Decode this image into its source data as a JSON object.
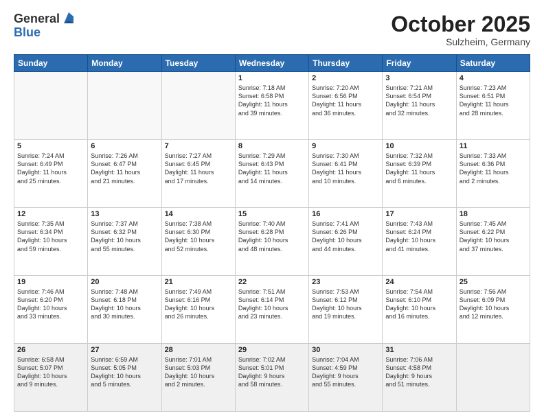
{
  "header": {
    "logo_general": "General",
    "logo_blue": "Blue",
    "month_title": "October 2025",
    "subtitle": "Sulzheim, Germany"
  },
  "days_of_week": [
    "Sunday",
    "Monday",
    "Tuesday",
    "Wednesday",
    "Thursday",
    "Friday",
    "Saturday"
  ],
  "weeks": [
    [
      {
        "day": "",
        "info": ""
      },
      {
        "day": "",
        "info": ""
      },
      {
        "day": "",
        "info": ""
      },
      {
        "day": "1",
        "info": "Sunrise: 7:18 AM\nSunset: 6:58 PM\nDaylight: 11 hours\nand 39 minutes."
      },
      {
        "day": "2",
        "info": "Sunrise: 7:20 AM\nSunset: 6:56 PM\nDaylight: 11 hours\nand 36 minutes."
      },
      {
        "day": "3",
        "info": "Sunrise: 7:21 AM\nSunset: 6:54 PM\nDaylight: 11 hours\nand 32 minutes."
      },
      {
        "day": "4",
        "info": "Sunrise: 7:23 AM\nSunset: 6:51 PM\nDaylight: 11 hours\nand 28 minutes."
      }
    ],
    [
      {
        "day": "5",
        "info": "Sunrise: 7:24 AM\nSunset: 6:49 PM\nDaylight: 11 hours\nand 25 minutes."
      },
      {
        "day": "6",
        "info": "Sunrise: 7:26 AM\nSunset: 6:47 PM\nDaylight: 11 hours\nand 21 minutes."
      },
      {
        "day": "7",
        "info": "Sunrise: 7:27 AM\nSunset: 6:45 PM\nDaylight: 11 hours\nand 17 minutes."
      },
      {
        "day": "8",
        "info": "Sunrise: 7:29 AM\nSunset: 6:43 PM\nDaylight: 11 hours\nand 14 minutes."
      },
      {
        "day": "9",
        "info": "Sunrise: 7:30 AM\nSunset: 6:41 PM\nDaylight: 11 hours\nand 10 minutes."
      },
      {
        "day": "10",
        "info": "Sunrise: 7:32 AM\nSunset: 6:39 PM\nDaylight: 11 hours\nand 6 minutes."
      },
      {
        "day": "11",
        "info": "Sunrise: 7:33 AM\nSunset: 6:36 PM\nDaylight: 11 hours\nand 2 minutes."
      }
    ],
    [
      {
        "day": "12",
        "info": "Sunrise: 7:35 AM\nSunset: 6:34 PM\nDaylight: 10 hours\nand 59 minutes."
      },
      {
        "day": "13",
        "info": "Sunrise: 7:37 AM\nSunset: 6:32 PM\nDaylight: 10 hours\nand 55 minutes."
      },
      {
        "day": "14",
        "info": "Sunrise: 7:38 AM\nSunset: 6:30 PM\nDaylight: 10 hours\nand 52 minutes."
      },
      {
        "day": "15",
        "info": "Sunrise: 7:40 AM\nSunset: 6:28 PM\nDaylight: 10 hours\nand 48 minutes."
      },
      {
        "day": "16",
        "info": "Sunrise: 7:41 AM\nSunset: 6:26 PM\nDaylight: 10 hours\nand 44 minutes."
      },
      {
        "day": "17",
        "info": "Sunrise: 7:43 AM\nSunset: 6:24 PM\nDaylight: 10 hours\nand 41 minutes."
      },
      {
        "day": "18",
        "info": "Sunrise: 7:45 AM\nSunset: 6:22 PM\nDaylight: 10 hours\nand 37 minutes."
      }
    ],
    [
      {
        "day": "19",
        "info": "Sunrise: 7:46 AM\nSunset: 6:20 PM\nDaylight: 10 hours\nand 33 minutes."
      },
      {
        "day": "20",
        "info": "Sunrise: 7:48 AM\nSunset: 6:18 PM\nDaylight: 10 hours\nand 30 minutes."
      },
      {
        "day": "21",
        "info": "Sunrise: 7:49 AM\nSunset: 6:16 PM\nDaylight: 10 hours\nand 26 minutes."
      },
      {
        "day": "22",
        "info": "Sunrise: 7:51 AM\nSunset: 6:14 PM\nDaylight: 10 hours\nand 23 minutes."
      },
      {
        "day": "23",
        "info": "Sunrise: 7:53 AM\nSunset: 6:12 PM\nDaylight: 10 hours\nand 19 minutes."
      },
      {
        "day": "24",
        "info": "Sunrise: 7:54 AM\nSunset: 6:10 PM\nDaylight: 10 hours\nand 16 minutes."
      },
      {
        "day": "25",
        "info": "Sunrise: 7:56 AM\nSunset: 6:09 PM\nDaylight: 10 hours\nand 12 minutes."
      }
    ],
    [
      {
        "day": "26",
        "info": "Sunrise: 6:58 AM\nSunset: 5:07 PM\nDaylight: 10 hours\nand 9 minutes."
      },
      {
        "day": "27",
        "info": "Sunrise: 6:59 AM\nSunset: 5:05 PM\nDaylight: 10 hours\nand 5 minutes."
      },
      {
        "day": "28",
        "info": "Sunrise: 7:01 AM\nSunset: 5:03 PM\nDaylight: 10 hours\nand 2 minutes."
      },
      {
        "day": "29",
        "info": "Sunrise: 7:02 AM\nSunset: 5:01 PM\nDaylight: 9 hours\nand 58 minutes."
      },
      {
        "day": "30",
        "info": "Sunrise: 7:04 AM\nSunset: 4:59 PM\nDaylight: 9 hours\nand 55 minutes."
      },
      {
        "day": "31",
        "info": "Sunrise: 7:06 AM\nSunset: 4:58 PM\nDaylight: 9 hours\nand 51 minutes."
      },
      {
        "day": "",
        "info": ""
      }
    ]
  ]
}
